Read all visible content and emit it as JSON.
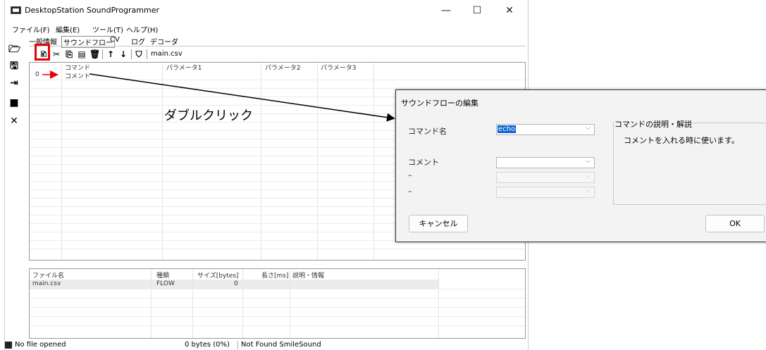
{
  "window": {
    "title": "DesktopStation SoundProgrammer",
    "minimize": "—",
    "maximize": "☐",
    "close": "✕"
  },
  "menu": [
    "ファイル(F)",
    "編集(E)",
    "ツール(T)",
    "ヘルプ(H)"
  ],
  "tabs": [
    "一般情報",
    "サウンドフロー",
    "CV",
    "ログ",
    "デコーダ"
  ],
  "active_tab": "サウンドフロー",
  "toolbar": {
    "file_name": "main.csv"
  },
  "flow_table": {
    "columns": [
      "コマンド",
      "パラメータ1",
      "パラメータ2",
      "パラメータ3"
    ],
    "rows": [
      {
        "index": "0",
        "command": "コメント"
      }
    ]
  },
  "file_table": {
    "columns": [
      "ファイル名",
      "種類",
      "サイズ[bytes]",
      "長さ[ms]",
      "説明・情報"
    ],
    "rows": [
      {
        "name": "main.csv",
        "type": "FLOW",
        "size": "0"
      }
    ]
  },
  "status": {
    "file": "No file opened",
    "bytes": "0 bytes (0%)",
    "device": "Not Found SmileSound"
  },
  "annotation": "ダブルクリック",
  "dialog": {
    "title": "サウンドフローの編集",
    "command_label": "コマンド名",
    "command_value": "echo",
    "comment_label": "コメント",
    "param2_label": "–",
    "param3_label": "–",
    "group_title": "コマンドの説明・解説",
    "description": "コメントを入れる時に使います。",
    "cancel": "キャンセル",
    "ok": "OK"
  },
  "colors": {
    "highlight_red": "#e8000b",
    "selection_blue": "#0a64d2"
  }
}
